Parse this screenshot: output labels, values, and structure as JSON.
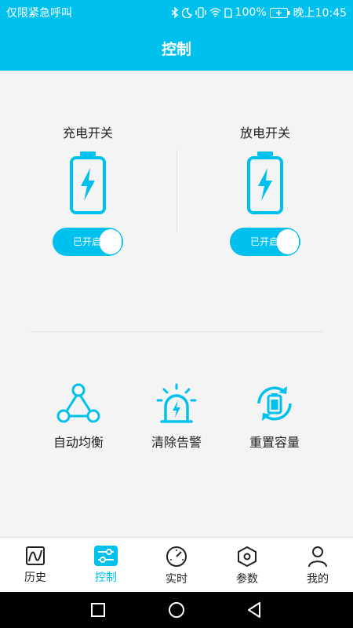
{
  "status_bar": {
    "carrier": "仅限紧急呼叫",
    "battery": "100%",
    "time": "晚上10:45"
  },
  "header": {
    "title": "控制"
  },
  "switches": [
    {
      "label": "充电开关",
      "state": "已开启",
      "on": true
    },
    {
      "label": "放电开关",
      "state": "已开启",
      "on": true
    }
  ],
  "actions": [
    {
      "label": "自动均衡",
      "icon": "triangle-network-icon"
    },
    {
      "label": "清除告警",
      "icon": "alarm-light-icon"
    },
    {
      "label": "重置容量",
      "icon": "battery-refresh-icon"
    }
  ],
  "tabs": [
    {
      "label": "历史",
      "icon": "chart-icon",
      "active": false
    },
    {
      "label": "控制",
      "icon": "sliders-icon",
      "active": true
    },
    {
      "label": "实时",
      "icon": "gauge-icon",
      "active": false
    },
    {
      "label": "参数",
      "icon": "hex-nut-icon",
      "active": false
    },
    {
      "label": "我的",
      "icon": "person-icon",
      "active": false
    }
  ],
  "colors": {
    "accent": "#00C0ED",
    "background": "#F4F4F4"
  }
}
